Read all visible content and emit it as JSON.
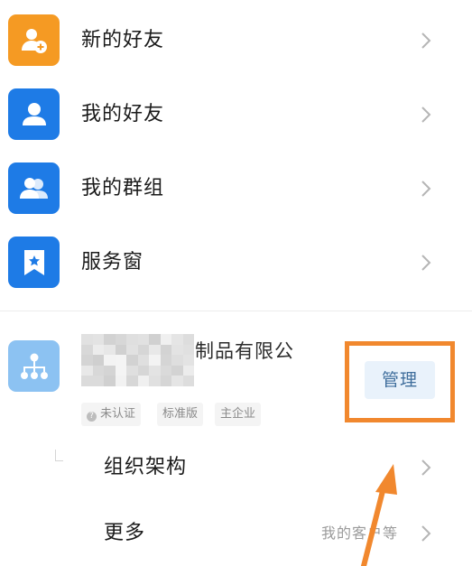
{
  "menu": [
    {
      "label": "新的好友",
      "icon": "add-friend-icon",
      "color": "#f59a23"
    },
    {
      "label": "我的好友",
      "icon": "friend-icon",
      "color": "#1e7be6"
    },
    {
      "label": "我的群组",
      "icon": "group-icon",
      "color": "#1e7be6"
    },
    {
      "label": "服务窗",
      "icon": "service-window-icon",
      "color": "#1e7be6"
    }
  ],
  "organization": {
    "icon": "organization-icon",
    "name_visible_suffix": "制品有限公",
    "tags": [
      "未认证",
      "标准版",
      "主企业"
    ],
    "manage_label": "管理",
    "highlight_color": "#f1882e"
  },
  "sub_items": [
    {
      "label": "组织架构",
      "hint": ""
    },
    {
      "label": "更多",
      "hint": "我的客户等"
    }
  ]
}
